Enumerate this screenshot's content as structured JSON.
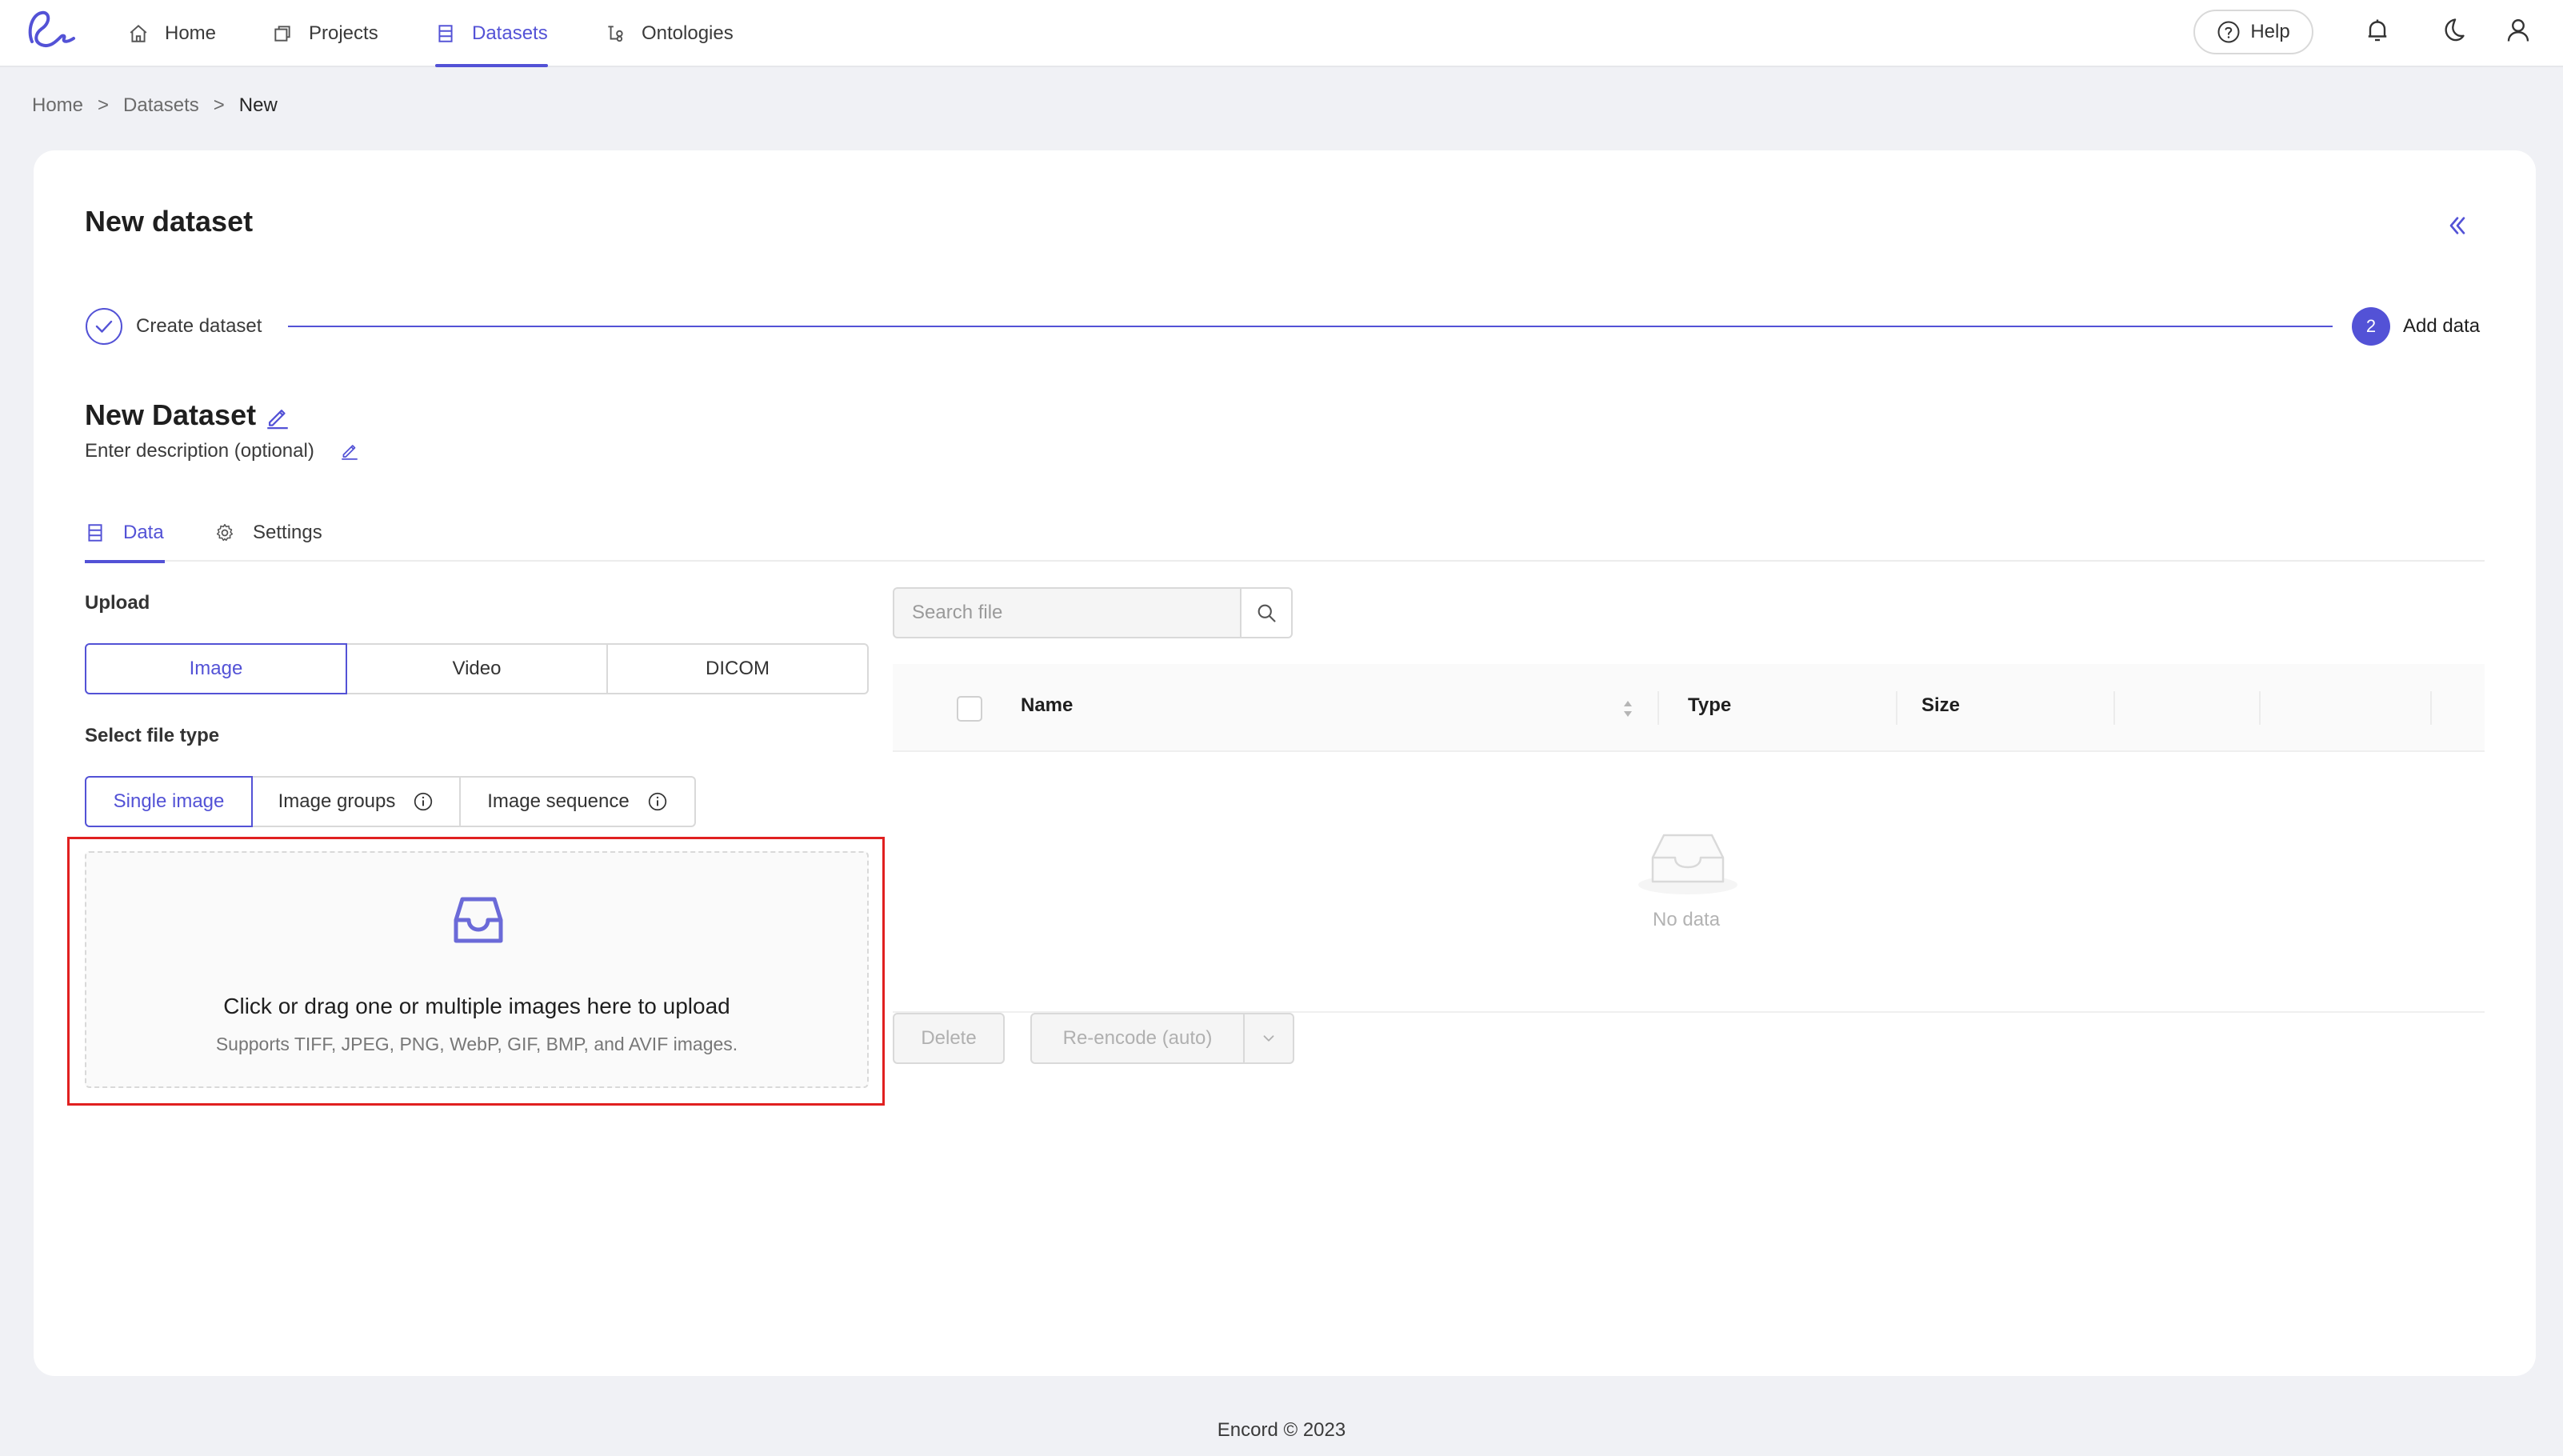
{
  "nav": {
    "items": [
      {
        "label": "Home",
        "icon": "home-icon"
      },
      {
        "label": "Projects",
        "icon": "projects-icon"
      },
      {
        "label": "Datasets",
        "icon": "datasets-icon"
      },
      {
        "label": "Ontologies",
        "icon": "ontologies-icon"
      }
    ],
    "active": "Datasets",
    "help_label": "Help",
    "accent_color": "#5352d6"
  },
  "breadcrumb": {
    "items": [
      "Home",
      "Datasets",
      "New"
    ],
    "separator": ">"
  },
  "page": {
    "title": "New dataset"
  },
  "steps": {
    "step1_label": "Create dataset",
    "step2_number": "2",
    "step2_label": "Add data"
  },
  "dataset": {
    "name": "New Dataset",
    "description_placeholder": "Enter description (optional)"
  },
  "tabs": {
    "data": "Data",
    "settings": "Settings"
  },
  "upload": {
    "label": "Upload",
    "media_types": [
      "Image",
      "Video",
      "DICOM"
    ],
    "selected_media": "Image",
    "file_type_label": "Select file type",
    "file_types": [
      "Single image",
      "Image groups",
      "Image sequence"
    ],
    "selected_file_type": "Single image",
    "drop_title": "Click or drag one or multiple images here to upload",
    "drop_subtitle": "Supports TIFF, JPEG, PNG, WebP, GIF, BMP, and AVIF images."
  },
  "files": {
    "search_placeholder": "Search file",
    "columns": [
      "Name",
      "Type",
      "Size"
    ],
    "empty_text": "No data",
    "delete_label": "Delete",
    "reencode_label": "Re-encode (auto)"
  },
  "footer": {
    "text": "Encord © 2023"
  }
}
